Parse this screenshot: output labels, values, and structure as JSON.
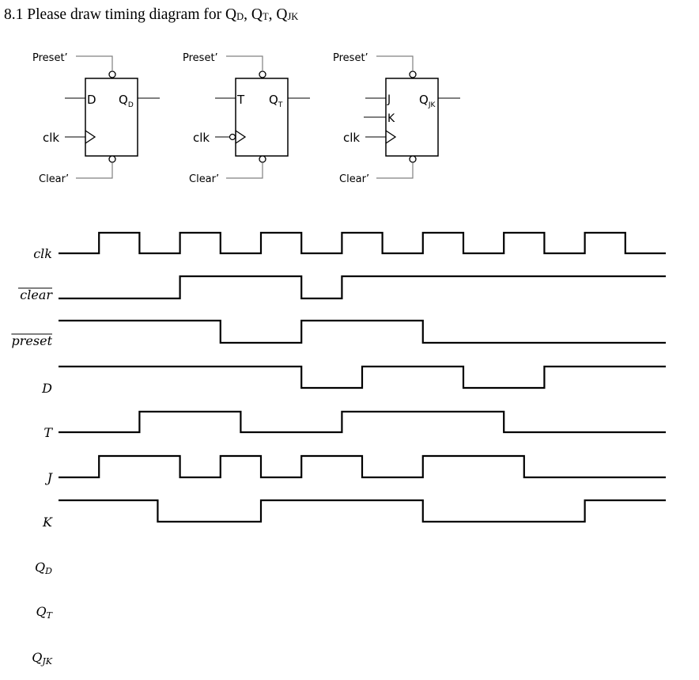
{
  "title": {
    "prefix": "8.1 Please draw timing diagram for ",
    "items": [
      {
        "base": "Q",
        "sub": "D",
        "sep": ", "
      },
      {
        "base": "Q",
        "sub": "T",
        "sep": ", "
      },
      {
        "base": "Q",
        "sub": "JK",
        "sep": ""
      }
    ]
  },
  "flip_flops": [
    {
      "name": "d-flip-flop",
      "preset_label": "Preset’",
      "clear_label": "Clear’",
      "clk_label": "clk",
      "inputs": [
        "D"
      ],
      "output_base": "Q",
      "output_sub": "D",
      "clk_inverted": false
    },
    {
      "name": "t-flip-flop",
      "preset_label": "Preset’",
      "clear_label": "Clear’",
      "clk_label": "clk",
      "inputs": [
        "T"
      ],
      "output_base": "Q",
      "output_sub": "T",
      "clk_inverted": true
    },
    {
      "name": "jk-flip-flop",
      "preset_label": "Preset’",
      "clear_label": "Clear’",
      "clk_label": "clk",
      "inputs": [
        "J",
        "K"
      ],
      "output_base": "Q",
      "output_sub": "JK",
      "clk_inverted": false
    }
  ],
  "timing": {
    "time_units": 15,
    "signals": [
      {
        "id": "clk",
        "label": "clk",
        "overline": false,
        "initial": 0,
        "transitions": [
          1,
          2,
          3,
          4,
          5,
          6,
          7,
          8,
          9,
          10,
          11,
          12,
          13,
          14
        ]
      },
      {
        "id": "clear",
        "label": "clear",
        "overline": true,
        "initial": 0,
        "transitions": [
          3,
          6,
          7
        ]
      },
      {
        "id": "preset",
        "label": "preset",
        "overline": true,
        "initial": 1,
        "transitions": [
          4,
          6,
          9
        ]
      },
      {
        "id": "d",
        "label": "D",
        "overline": false,
        "initial": 1,
        "transitions": [
          6,
          7.5,
          10,
          12
        ]
      },
      {
        "id": "t",
        "label": "T",
        "overline": false,
        "initial": 0,
        "transitions": [
          2,
          4.5,
          7,
          11
        ]
      },
      {
        "id": "j",
        "label": "J",
        "overline": false,
        "initial": 0,
        "transitions": [
          1,
          3,
          4,
          5,
          6,
          7.5,
          9,
          11.5
        ]
      },
      {
        "id": "k",
        "label": "K",
        "overline": false,
        "initial": 1,
        "transitions": [
          2.45,
          5,
          9,
          13
        ]
      }
    ],
    "answer_rows": [
      {
        "id": "qd",
        "base": "Q",
        "sub": "D"
      },
      {
        "id": "qt",
        "base": "Q",
        "sub": "T"
      },
      {
        "id": "qjk",
        "base": "Q",
        "sub": "JK"
      }
    ]
  }
}
